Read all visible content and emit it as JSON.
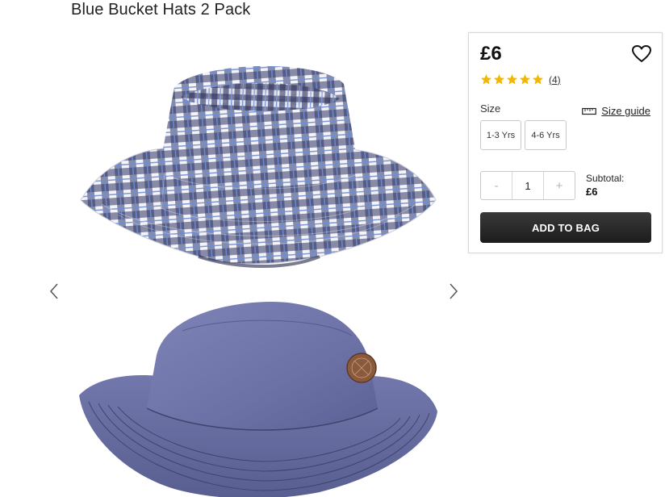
{
  "product": {
    "title": "Blue Bucket Hats 2 Pack"
  },
  "gallery": {
    "images": [
      "blue-white-gingham-bucket-hat",
      "chambray-bucket-hat"
    ],
    "prev_icon": "chevron-left-icon",
    "next_icon": "chevron-right-icon"
  },
  "buy_box": {
    "price": "£6",
    "wishlist_icon": "heart-outline-icon",
    "rating": {
      "stars": 5,
      "max": 5,
      "review_count": "(4)",
      "star_color": "#f5b800"
    },
    "size": {
      "label": "Size",
      "guide_label": "Size guide",
      "guide_icon": "ruler-icon",
      "options": [
        "1-3 Yrs",
        "4-6 Yrs"
      ]
    },
    "quantity": {
      "minus": "-",
      "value": "1",
      "plus": "+"
    },
    "subtotal": {
      "label": "Subtotal:",
      "value": "£6"
    },
    "add_to_bag_label": "ADD TO BAG"
  },
  "colors": {
    "button_dark": "#262626",
    "gingham_navy": "#2e3466",
    "gingham_blue": "#6f8ed2",
    "chambray": "#6c72a6"
  }
}
